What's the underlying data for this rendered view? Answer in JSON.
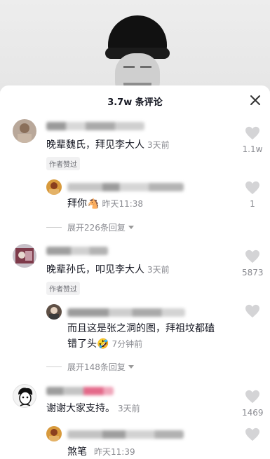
{
  "sheet": {
    "title": "3.7w 条评论"
  },
  "comments": [
    {
      "text": "晚辈魏氏，拜见李大人",
      "time": "3天前",
      "tag": "作者赞过",
      "likes": "1.1w",
      "reply": {
        "text": "拜你",
        "emoji": "🐴",
        "time": "昨天11:38",
        "likes": "1"
      },
      "expand": "展开226条回复"
    },
    {
      "text": "晚辈孙氏，叩见李大人",
      "time": "3天前",
      "tag": "作者赞过",
      "likes": "5873",
      "reply": {
        "text_line1": "而且这是张之洞的图，拜祖坟都磕",
        "text_line2": "错了头",
        "emoji": "🤣",
        "time": "7分钟前"
      },
      "expand": "展开148条回复"
    },
    {
      "text": "谢谢大家支持。",
      "time": "3天前",
      "likes": "1469",
      "reply": {
        "text": "煞笔",
        "time": "昨天11:39"
      }
    }
  ]
}
